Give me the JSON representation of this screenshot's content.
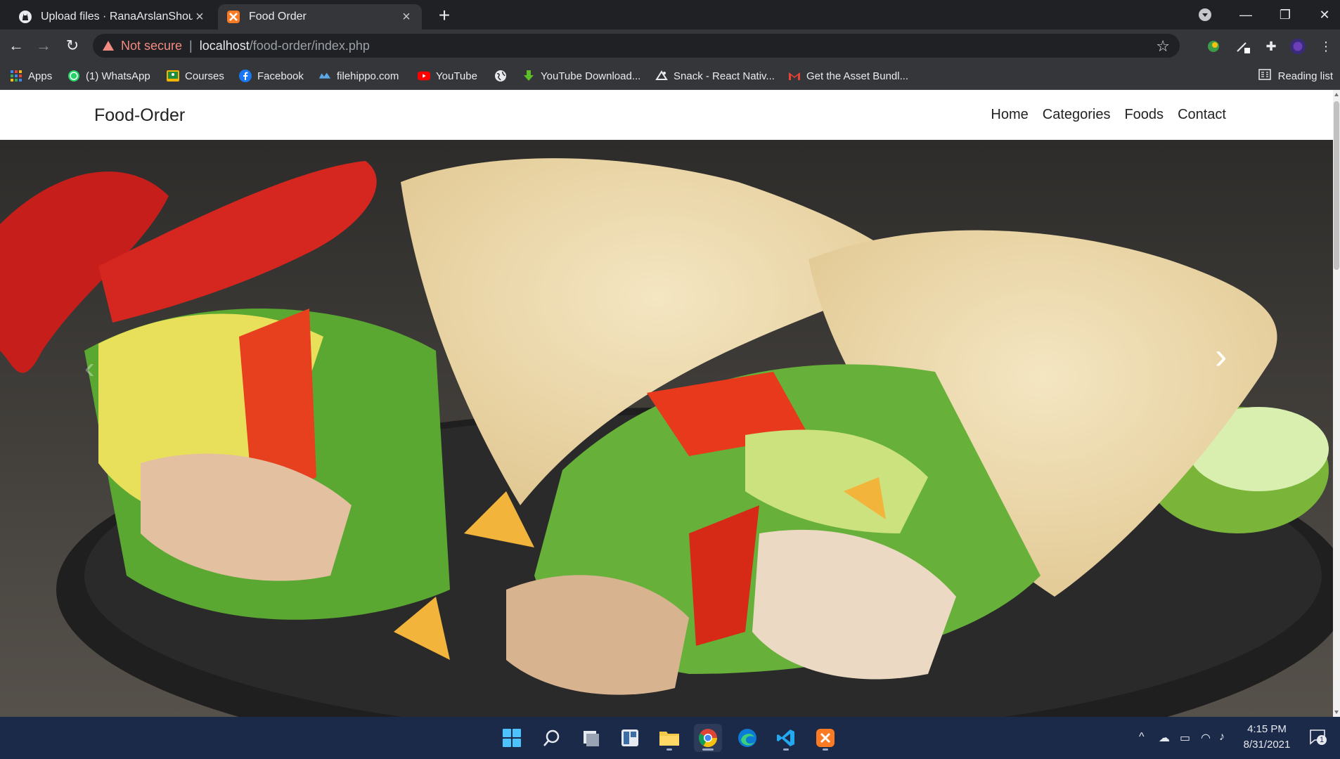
{
  "browser": {
    "tabs": [
      {
        "title": "Upload files · RanaArslanShoukat",
        "icon": "github-icon",
        "active": false
      },
      {
        "title": "Food Order",
        "icon": "xampp-icon",
        "active": true
      }
    ],
    "address": {
      "security_label": "Not secure",
      "host": "localhost",
      "path": "/food-order/index.php"
    },
    "bookmarks": [
      {
        "label": "Apps",
        "icon": "apps-grid-icon"
      },
      {
        "label": "(1) WhatsApp",
        "icon": "whatsapp-icon"
      },
      {
        "label": "Courses",
        "icon": "classroom-icon"
      },
      {
        "label": "Facebook",
        "icon": "facebook-icon"
      },
      {
        "label": "filehippo.com",
        "icon": "filehippo-icon"
      },
      {
        "label": "YouTube",
        "icon": "youtube-icon"
      },
      {
        "label": "",
        "icon": "globe-icon"
      },
      {
        "label": "YouTube Download...",
        "icon": "download-icon"
      },
      {
        "label": "Snack - React Nativ...",
        "icon": "snack-icon"
      },
      {
        "label": "Get the Asset Bundl...",
        "icon": "gmail-icon"
      }
    ],
    "reading_list_label": "Reading list"
  },
  "site": {
    "brand": "Food-Order",
    "menu": [
      "Home",
      "Categories",
      "Foods",
      "Contact"
    ],
    "hero": {
      "image": "chicken-wrap-photo",
      "next_icon": "chevron-right-icon",
      "prev_icon": "chevron-left-icon"
    }
  },
  "taskbar": {
    "time": "4:15 PM",
    "date": "8/31/2021",
    "notification_count": "1"
  },
  "colors": {
    "tab_bg": "#202124",
    "toolbar_bg": "#35363a",
    "not_secure": "#f28b82",
    "taskbar_bg": "#1c2a4a"
  }
}
